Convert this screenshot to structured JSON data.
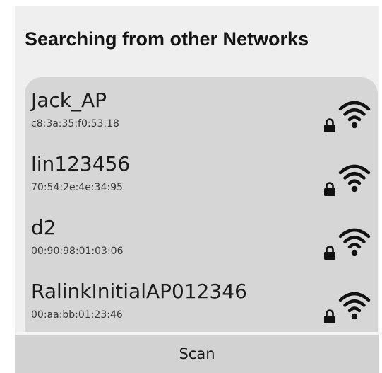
{
  "header": {
    "title": "Searching from other Networks"
  },
  "networks": [
    {
      "ssid": "Jack_AP",
      "bssid": "c8:3a:35:f0:53:18",
      "secured": true,
      "signal_icon": "wifi-full-icon"
    },
    {
      "ssid": "lin123456",
      "bssid": "70:54:2e:4e:34:95",
      "secured": true,
      "signal_icon": "wifi-full-icon"
    },
    {
      "ssid": "d2",
      "bssid": "00:90:98:01:03:06",
      "secured": true,
      "signal_icon": "wifi-full-icon"
    },
    {
      "ssid": "RalinkInitialAP012346",
      "bssid": "00:aa:bb:01:23:46",
      "secured": true,
      "signal_icon": "wifi-full-icon"
    }
  ],
  "footer": {
    "scan_label": "Scan"
  },
  "colors": {
    "panel_background": "#efefef",
    "list_background": "#d6d6d6",
    "button_background": "#d2d2d2",
    "icon_color": "#111111"
  }
}
